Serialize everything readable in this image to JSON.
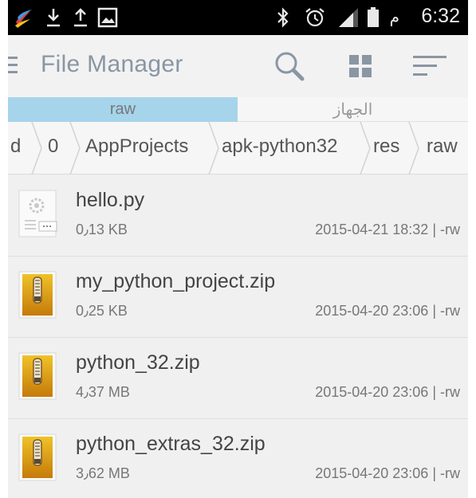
{
  "status_bar": {
    "icons": [
      "app-logo-icon",
      "download-icon",
      "upload-icon",
      "gallery-icon",
      "bluetooth-icon",
      "alarm-icon",
      "signal-icon",
      "battery-icon"
    ],
    "time_suffix": "م",
    "time": "6:32"
  },
  "app_bar": {
    "title": "File Manager",
    "actions": [
      "search-icon",
      "grid-view-icon",
      "sort-icon"
    ]
  },
  "tabs": [
    {
      "label": "raw",
      "active": true,
      "color": "#a6d4eb"
    },
    {
      "label": "الجهاز",
      "active": false
    }
  ],
  "breadcrumb": [
    "d",
    "0",
    "AppProjects",
    "apk-python32",
    "res",
    "raw"
  ],
  "files": [
    {
      "name": "hello.py",
      "size": "0٫13 KB",
      "meta": "2015-04-21 18:32 | -rw",
      "icon": "script-file-icon"
    },
    {
      "name": "my_python_project.zip",
      "size": "0٫25 KB",
      "meta": "2015-04-20 23:06 | -rw",
      "icon": "zip-archive-icon"
    },
    {
      "name": "python_32.zip",
      "size": "4٫37 MB",
      "meta": "2015-04-20 23:06 | -rw",
      "icon": "zip-archive-icon"
    },
    {
      "name": "python_extras_32.zip",
      "size": "3٫62 MB",
      "meta": "2015-04-20 23:06 | -rw",
      "icon": "zip-archive-icon"
    }
  ]
}
